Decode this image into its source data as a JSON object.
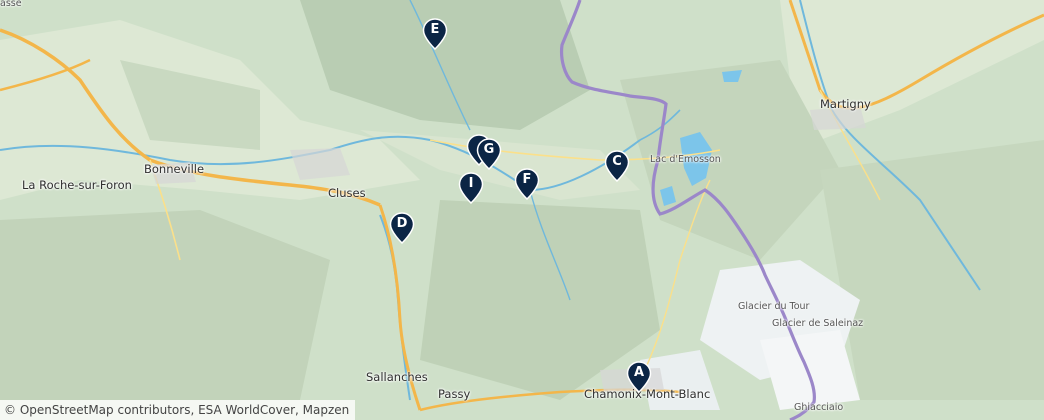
{
  "places": [
    {
      "id": "bonneville",
      "name": "Bonneville",
      "size": "large"
    },
    {
      "id": "la-roche",
      "name": "La Roche-sur-Foron",
      "size": "large"
    },
    {
      "id": "cluses",
      "name": "Cluses",
      "size": "large"
    },
    {
      "id": "sallanches",
      "name": "Sallanches",
      "size": "large"
    },
    {
      "id": "passy",
      "name": "Passy",
      "size": "large"
    },
    {
      "id": "chamonix",
      "name": "Chamonix-Mont-Blanc",
      "size": "large"
    },
    {
      "id": "martigny",
      "name": "Martigny",
      "size": "large"
    },
    {
      "id": "lac-emosson",
      "name": "Lac d'Emosson",
      "size": "small"
    },
    {
      "id": "glacier-tour",
      "name": "Glacier du Tour",
      "size": "small"
    },
    {
      "id": "glacier-saleinaz",
      "name": "Glacier de Saleinaz",
      "size": "small"
    },
    {
      "id": "ghiacciaio",
      "name": "Ghiacciaio",
      "size": "small"
    },
    {
      "id": "corner-top",
      "name": "asse",
      "size": "small"
    }
  ],
  "markers": [
    {
      "id": "A",
      "label": "A"
    },
    {
      "id": "C",
      "label": "C"
    },
    {
      "id": "D",
      "label": "D"
    },
    {
      "id": "E",
      "label": "E"
    },
    {
      "id": "F",
      "label": "F"
    },
    {
      "id": "G",
      "label": "G"
    },
    {
      "id": "H",
      "label": ""
    },
    {
      "id": "I",
      "label": "I"
    }
  ],
  "attribution": "© OpenStreetMap contributors, ESA WorldCover, Mapzen",
  "colors": {
    "marker": "#0b2545",
    "border": "#9b87c9",
    "motorway": "#f3b64a",
    "river": "#6fb8dc",
    "lake": "#7cc5ea",
    "glacier": "#f4f6f7"
  }
}
